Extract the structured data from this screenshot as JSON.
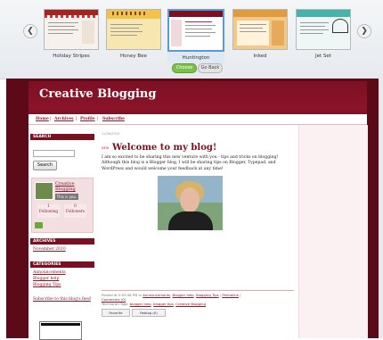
{
  "picker": {
    "prev_icon": "chevron-left-icon",
    "next_icon": "chevron-right-icon",
    "themes": [
      {
        "name": "Holiday Stripes",
        "accent": "#a62323"
      },
      {
        "name": "Honey Bee",
        "accent": "#f3c24a"
      },
      {
        "name": "Huntington",
        "accent": "#7b1022",
        "selected": true
      },
      {
        "name": "Inked",
        "accent": "#e19b3c"
      },
      {
        "name": "Jet Set",
        "accent": "#46b3a8"
      }
    ],
    "choose_label": "Choose",
    "goback_label": "Go Back"
  },
  "blog": {
    "title": "Creative Blogging",
    "nav": [
      "Home",
      "Archives",
      "Profile",
      "Subscribe"
    ],
    "nav_sep": "|",
    "colors": {
      "frame": "#5c0a17",
      "header": "#7d1023",
      "link": "#8b1a2c"
    }
  },
  "sidebar": {
    "search_heading": "SEARCH",
    "search_button": "Search",
    "follow": {
      "link_line1": "Creative",
      "link_line2": "Blogging",
      "this_is_you": "This is you.",
      "following_count": "1",
      "following_label": "Following",
      "followers_count": "0",
      "followers_label": "Followers"
    },
    "archives_heading": "ARCHIVES",
    "archives": [
      "November 2010"
    ],
    "categories_heading": "CATEGORIES",
    "categories": [
      "Announcements",
      "Blogger help",
      "Blogging Tips"
    ],
    "subscribe_link": "Subscribe to this blog's feed"
  },
  "post": {
    "date": "11/08/2010",
    "new_badge": "NEW",
    "title": "Welcome to my blog!",
    "body": "I am so excited to be sharing this new venture with you - tips and tricks on blogging! Although this blog is a Blogger blog, I will be sharing tips on Blogger, Typepad, and WordPress and would welcome your feedback at any time!",
    "meta_prefix": "Posted at 5:03:48 PM in",
    "meta_categories": [
      "Announcements",
      "Blogger help",
      "Blogging Tips"
    ],
    "permalink": "Permalink",
    "comments": "Comments (0)",
    "tags_prefix": "Technorati Tags:",
    "tags": [
      "blogger help",
      "blogger tips",
      "Creative Blogging"
    ],
    "favorite_label": "Favorite",
    "reblog_label": "Reblog (0)"
  }
}
